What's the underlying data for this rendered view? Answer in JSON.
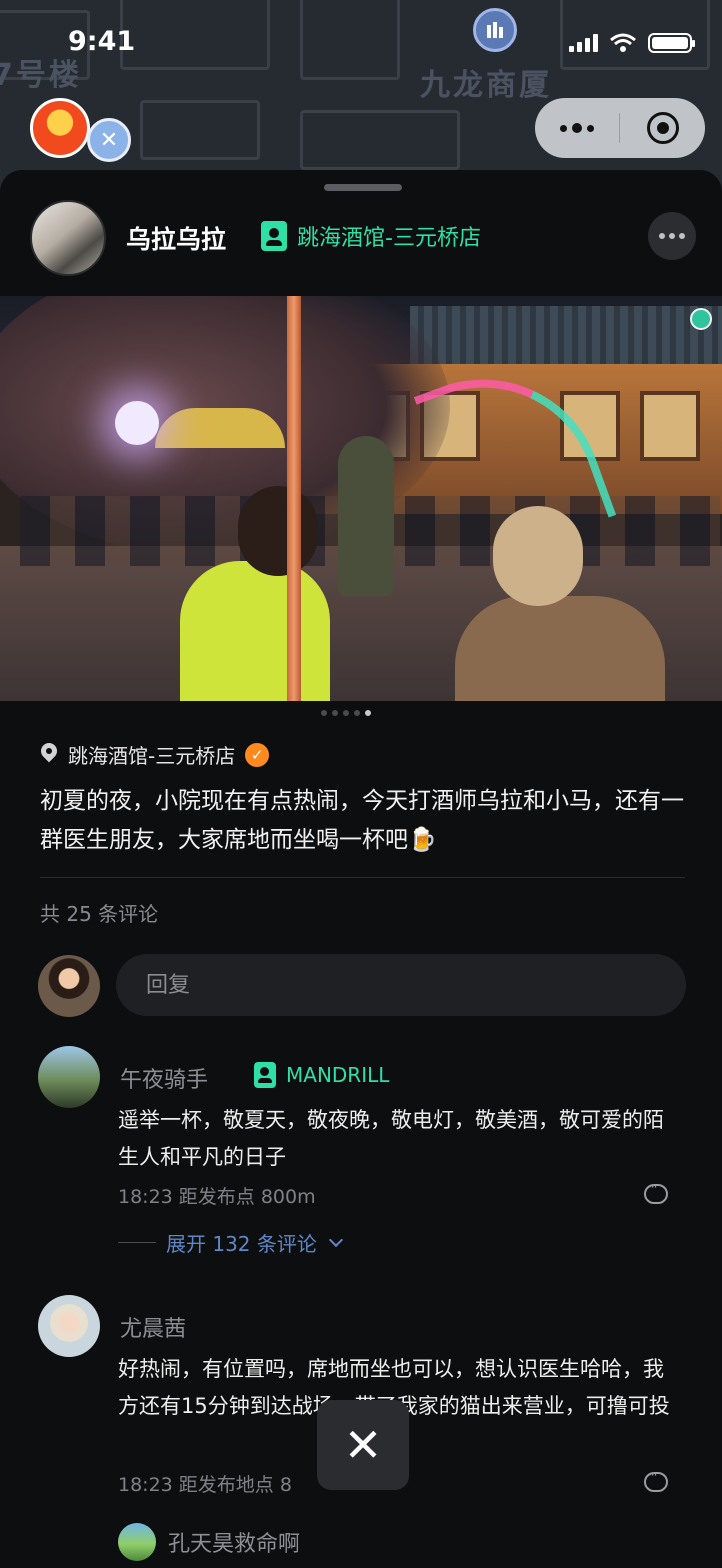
{
  "status_bar": {
    "time": "9:41"
  },
  "map": {
    "labels": [
      "7号楼",
      "九龙商厦"
    ]
  },
  "post": {
    "author": "乌拉乌拉",
    "venue_tag": "跳海酒馆-三元桥店",
    "location": "跳海酒馆-三元桥店",
    "text": "初夏的夜，小院现在有点热闹，今天打酒师乌拉和小马，还有一群医生朋友，大家席地而坐喝一杯吧🍺",
    "image_count": 5,
    "active_image": 5
  },
  "comments_header": {
    "count_text": "共 25 条评论"
  },
  "reply_box": {
    "placeholder": "回复"
  },
  "comments": [
    {
      "name": "午夜骑手",
      "tag": "MANDRILL",
      "text": "遥举一杯，敬夏天，敬夜晚，敬电灯，敬美酒，敬可爱的陌生人和平凡的日子",
      "meta": "18:23   距发布点 800m",
      "expand": "展开 132 条评论"
    },
    {
      "name": "尤晨茜",
      "text": "好热闹，有位置吗，席地而坐也可以，想认识医生哈哈，我方还有15分钟到达战场，带了我家的猫出来营业，可撸可投",
      "meta": "18:23   距发布地点 8"
    }
  ],
  "sub_reply": {
    "name": "孔天昊救命啊"
  },
  "close_button": {
    "icon": "close-icon"
  }
}
